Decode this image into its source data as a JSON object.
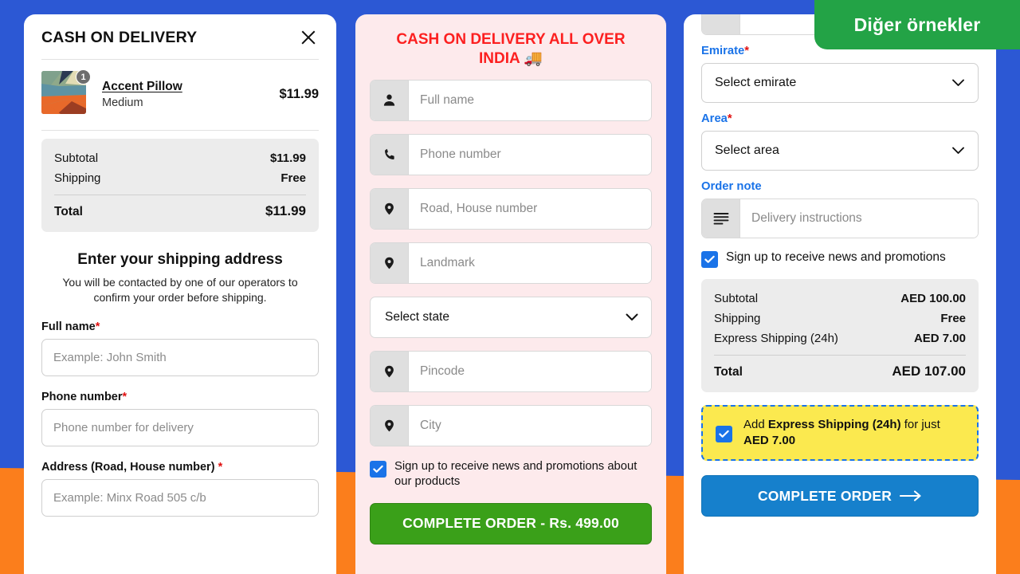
{
  "ribbon": {
    "label": "Diğer örnekler"
  },
  "theme": {
    "bg_blue": "#2c58d4",
    "bg_orange": "#fb7e1c",
    "ribbon_green": "#23a346",
    "accent_blue": "#1a73e8",
    "alert_red": "#fc2020",
    "promo_yellow": "#fbe94f",
    "btn_green": "#3aa019",
    "btn_blue": "#1680cc"
  },
  "panel1": {
    "title": "CASH ON DELIVERY",
    "close_icon": "close-icon",
    "line_item": {
      "name": "Accent Pillow",
      "variant": "Medium",
      "price": "$11.99",
      "quantity": "1"
    },
    "totals": {
      "subtotal_label": "Subtotal",
      "subtotal_value": "$11.99",
      "shipping_label": "Shipping",
      "shipping_value": "Free",
      "total_label": "Total",
      "total_value": "$11.99"
    },
    "heading": "Enter your shipping address",
    "subheading": "You will be contacted by one of our operators to confirm your order before shipping.",
    "fields": [
      {
        "label": "Full name",
        "required": "*",
        "placeholder": "Example: John Smith"
      },
      {
        "label": "Phone number",
        "required": "*",
        "placeholder": "Phone number for delivery"
      },
      {
        "label": "Address (Road, House number)",
        "required": "*",
        "placeholder": "Example: Minx Road 505 c/b"
      }
    ]
  },
  "panel2": {
    "title": "CASH ON DELIVERY ALL OVER INDIA 🚚",
    "fields": [
      {
        "icon": "person-icon",
        "placeholder": "Full name"
      },
      {
        "icon": "phone-icon",
        "placeholder": "Phone number"
      },
      {
        "icon": "location-pin-icon",
        "placeholder": "Road, House number"
      },
      {
        "icon": "location-pin-icon",
        "placeholder": "Landmark"
      }
    ],
    "state_select": {
      "value": "Select state",
      "icon": "chevron-down-icon"
    },
    "fields2": [
      {
        "icon": "location-pin-icon",
        "placeholder": "Pincode"
      },
      {
        "icon": "location-pin-icon",
        "placeholder": "City"
      }
    ],
    "newsletter": {
      "checked": true,
      "label": "Sign up to receive news and promotions about our products"
    },
    "submit": {
      "label": "COMPLETE ORDER - Rs. 499.00"
    }
  },
  "panel3": {
    "emirate_label": "Emirate",
    "emirate_required": "*",
    "emirate_select": {
      "value": "Select emirate",
      "icon": "chevron-down-icon"
    },
    "area_label": "Area",
    "area_required": "*",
    "area_select": {
      "value": "Select area",
      "icon": "chevron-down-icon"
    },
    "note_label": "Order note",
    "note_field": {
      "icon": "lines-icon",
      "placeholder": "Delivery instructions"
    },
    "newsletter": {
      "checked": true,
      "label": "Sign up to receive news and promotions"
    },
    "totals": {
      "subtotal_label": "Subtotal",
      "subtotal_value": "AED 100.00",
      "shipping_label": "Shipping",
      "shipping_value": "Free",
      "express_label": "Express Shipping (24h)",
      "express_value": "AED 7.00",
      "total_label": "Total",
      "total_value": "AED 107.00"
    },
    "promo": {
      "checked": true,
      "prefix": "Add ",
      "strong1": "Express Shipping (24h)",
      "middle": " for just ",
      "strong2": "AED 7.00"
    },
    "submit": {
      "label": "COMPLETE ORDER",
      "icon": "arrow-right-icon"
    }
  }
}
